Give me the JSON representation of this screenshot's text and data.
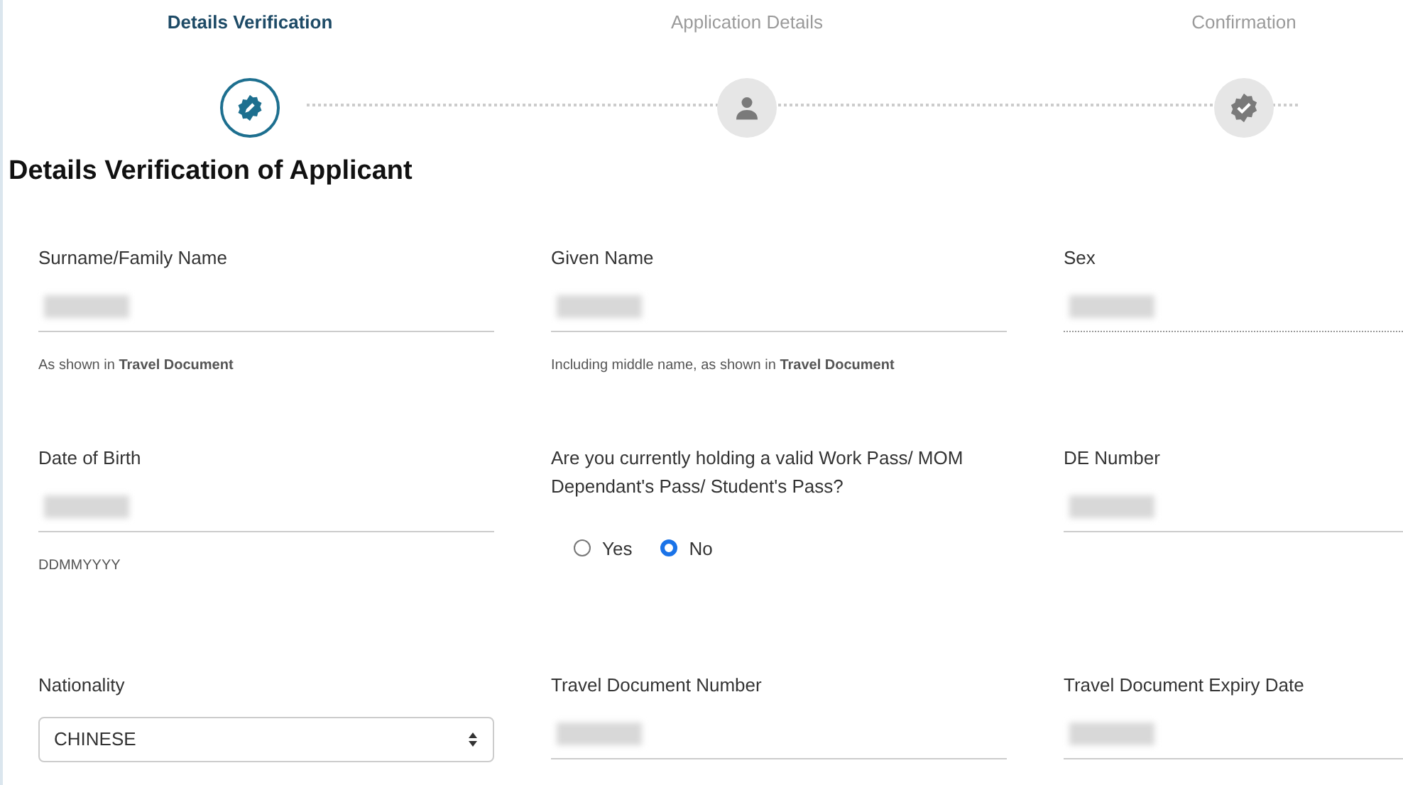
{
  "steps": [
    {
      "label": "Details Verification",
      "kind": "verify",
      "selected": true
    },
    {
      "label": "Application Details",
      "kind": "person",
      "selected": false
    },
    {
      "label": "Confirmation",
      "kind": "check",
      "selected": false
    }
  ],
  "heading": "Details Verification of Applicant",
  "fields": [
    {
      "kind": "text",
      "label": "Surname/Family Name",
      "hint": "As shown in **Travel Document**",
      "disabled": false
    },
    {
      "kind": "text",
      "label": "Given Name",
      "hint": "Including middle name, as shown in **Travel Document**",
      "disabled": false
    },
    {
      "kind": "text",
      "label": "Sex",
      "disabled": true
    },
    {
      "kind": "text",
      "label": "Date of Birth",
      "hint": "DDMMYYYY",
      "disabled": false
    },
    {
      "kind": "radio",
      "label": "Are you currently holding a valid Work Pass/ MOM Dependant's Pass/ Student's Pass?",
      "options": [
        {
          "label": "Yes",
          "selected": false
        },
        {
          "label": "No",
          "selected": true
        }
      ]
    },
    {
      "kind": "text",
      "label": "DE Number",
      "disabled": false
    },
    {
      "kind": "select",
      "label": "Nationality",
      "value": "CHINESE"
    },
    {
      "kind": "text",
      "label": "Travel Document Number",
      "disabled": false
    },
    {
      "kind": "text",
      "label": "Travel Document Expiry Date",
      "disabled": false
    }
  ]
}
